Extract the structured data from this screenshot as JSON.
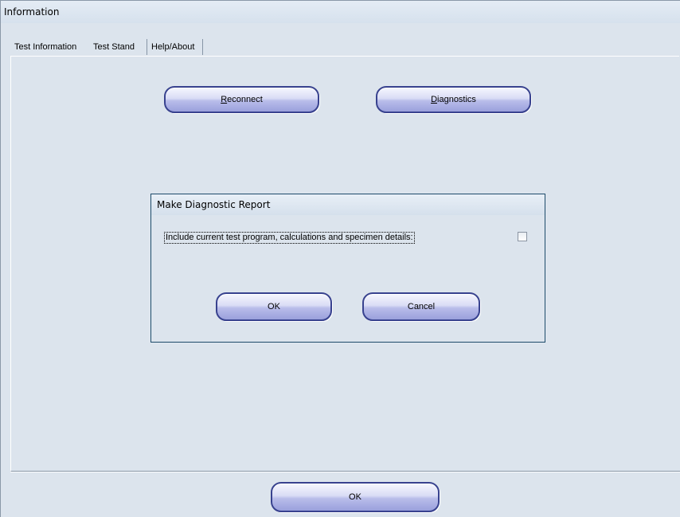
{
  "window": {
    "title": "Information"
  },
  "tabs": [
    {
      "label": "Test Information"
    },
    {
      "label": "Test Stand"
    },
    {
      "label": "Help/About"
    }
  ],
  "panel": {
    "reconnect_label_first": "R",
    "reconnect_label_rest": "econnect",
    "diagnostics_label_first": "D",
    "diagnostics_label_rest": "iagnostics"
  },
  "dialog": {
    "title": "Make Diagnostic Report",
    "checkbox_label": "Include current test program, calculations and specimen details:",
    "checkbox_checked": false,
    "ok_label": "OK",
    "cancel_label": "Cancel"
  },
  "footer": {
    "ok_label": "OK"
  },
  "colors": {
    "button_border": "#38428f",
    "background": "#dce4ed",
    "dialog_border": "#1d4b6a"
  }
}
